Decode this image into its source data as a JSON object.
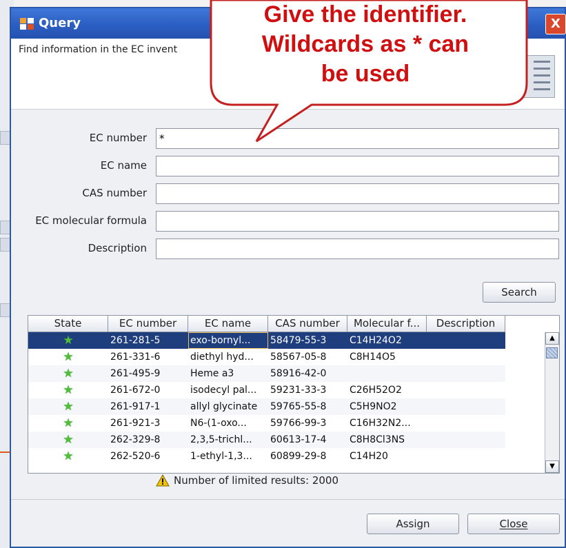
{
  "window": {
    "title": "Query",
    "close_glyph": "X",
    "header_text": "Find information in the EC invent",
    "header_graphic_icon": "form-document-icon"
  },
  "callout": {
    "lines": [
      "Give the identifier.",
      "Wildcards as * can",
      "be used"
    ],
    "color": "#d01010"
  },
  "form": {
    "fields": [
      {
        "label": "EC number",
        "value": "*"
      },
      {
        "label": "EC name",
        "value": ""
      },
      {
        "label": "CAS number",
        "value": ""
      },
      {
        "label": "EC molecular formula",
        "value": ""
      },
      {
        "label": "Description",
        "value": ""
      }
    ],
    "search_label": "Search"
  },
  "table": {
    "columns": [
      "State",
      "EC number",
      "EC name",
      "CAS number",
      "Molecular f...",
      "Description"
    ],
    "rows": [
      {
        "state": "★",
        "ec_number": "261-281-5",
        "ec_name": "exo-bornyl...",
        "cas": "58479-55-3",
        "formula": "C14H24O2",
        "description": ""
      },
      {
        "state": "★",
        "ec_number": "261-331-6",
        "ec_name": "diethyl hyd...",
        "cas": "58567-05-8",
        "formula": "C8H14O5",
        "description": ""
      },
      {
        "state": "★",
        "ec_number": "261-495-9",
        "ec_name": "Heme a3",
        "cas": "58916-42-0",
        "formula": "",
        "description": ""
      },
      {
        "state": "★",
        "ec_number": "261-672-0",
        "ec_name": "isodecyl pal...",
        "cas": "59231-33-3",
        "formula": "C26H52O2",
        "description": ""
      },
      {
        "state": "★",
        "ec_number": "261-917-1",
        "ec_name": "allyl glycinate",
        "cas": "59765-55-8",
        "formula": "C5H9NO2",
        "description": ""
      },
      {
        "state": "★",
        "ec_number": "261-921-3",
        "ec_name": "N6-(1-oxo...",
        "cas": "59766-99-3",
        "formula": "C16H32N2...",
        "description": ""
      },
      {
        "state": "★",
        "ec_number": "262-329-8",
        "ec_name": "2,3,5-trichl...",
        "cas": "60613-17-4",
        "formula": "C8H8Cl3NS",
        "description": ""
      },
      {
        "state": "★",
        "ec_number": "262-520-6",
        "ec_name": "1-ethyl-1,3...",
        "cas": "60899-29-8",
        "formula": "C14H20",
        "description": ""
      }
    ],
    "selected_row": 0,
    "scroll_up": "▲",
    "scroll_down": "▼"
  },
  "status": {
    "limit_text": "Number of limited results:  2000"
  },
  "footer": {
    "assign_label": "Assign",
    "close_label": "Close"
  },
  "colors": {
    "titlebar": "#2a5cc0",
    "selection": "#1f3e7e",
    "state_star": "#4fbf3a"
  }
}
